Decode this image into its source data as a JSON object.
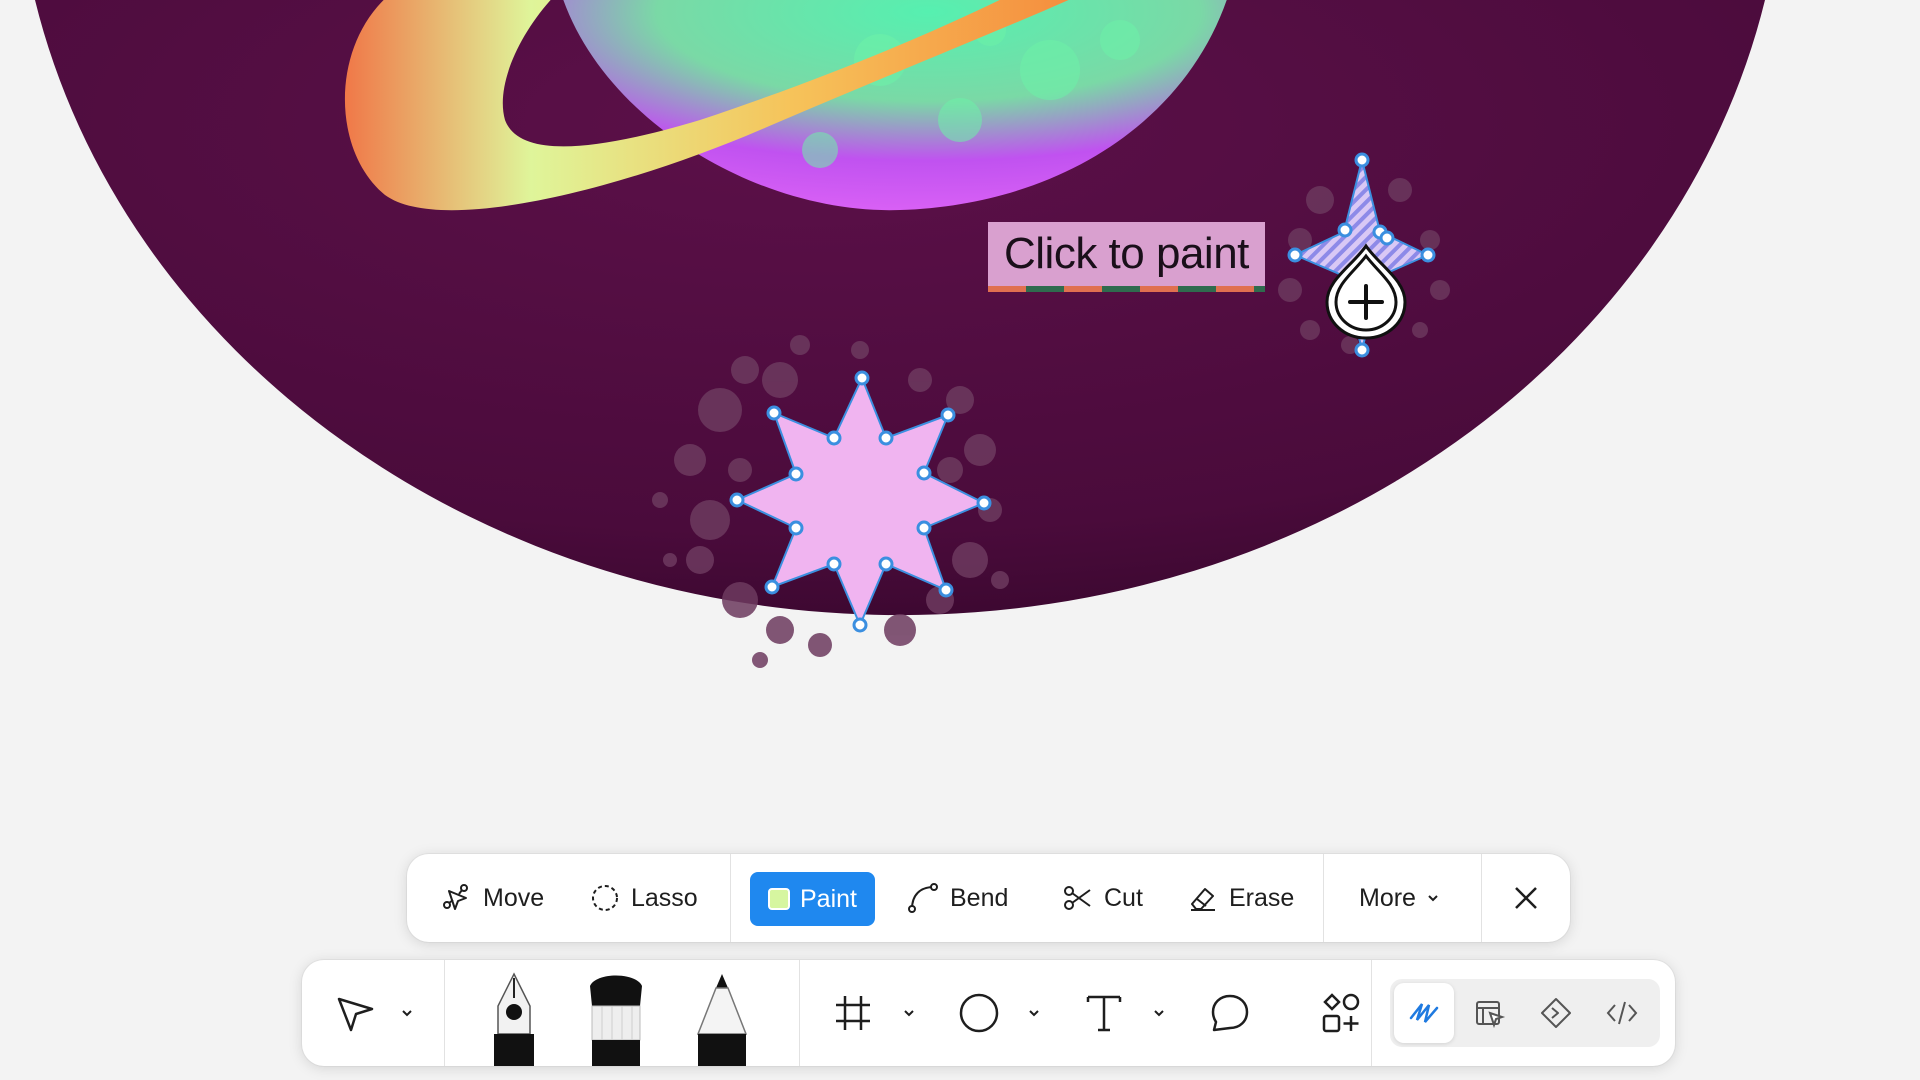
{
  "canvas": {
    "tooltip_text": "Click to paint",
    "colors": {
      "background": "#f3f3f3",
      "planet_disc": "#4a0a3a",
      "shape_fill": "#f0b4f0",
      "selection_handle": "#3b8fe0"
    }
  },
  "edit_toolbar": {
    "move": {
      "label": "Move",
      "icon": "move-icon"
    },
    "lasso": {
      "label": "Lasso",
      "icon": "lasso-icon"
    },
    "paint": {
      "label": "Paint",
      "icon": "paint-swatch",
      "active": true
    },
    "bend": {
      "label": "Bend",
      "icon": "bend-icon"
    },
    "cut": {
      "label": "Cut",
      "icon": "scissors-icon"
    },
    "erase": {
      "label": "Erase",
      "icon": "eraser-icon"
    },
    "more": {
      "label": "More",
      "icon": "chevron-down-icon"
    },
    "close": {
      "icon": "close-icon"
    },
    "accent": "#1f88ef"
  },
  "main_toolbar": {
    "tools": [
      "pointer-tool",
      "pen-tool",
      "brush-tool",
      "pencil-tool",
      "frame-tool",
      "ellipse-tool",
      "text-tool",
      "comment-tool",
      "components-tool"
    ],
    "mode_switcher": [
      "draw-mode",
      "design-mode",
      "prototype-mode",
      "dev-mode"
    ],
    "active_mode": "draw-mode"
  }
}
